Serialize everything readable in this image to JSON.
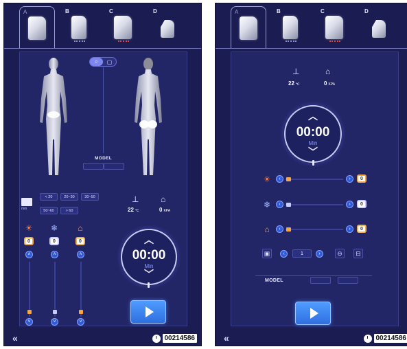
{
  "tabs": [
    {
      "letter": "A",
      "active": true
    },
    {
      "letter": "B",
      "active": false,
      "dots": "blue"
    },
    {
      "letter": "C",
      "active": false,
      "dots": "red"
    },
    {
      "letter": "D",
      "active": false
    }
  ],
  "left_panel": {
    "model_label": "MODEL",
    "view_toggle": [
      "⌕",
      "▢"
    ],
    "ranges": [
      "< 20",
      "20~30",
      "30~50",
      "50~60",
      "> 60"
    ],
    "mm_label": "mm",
    "temperature": {
      "value": "22",
      "unit": "℃"
    },
    "pressure": {
      "value": "0",
      "unit": "KPA"
    },
    "controls": [
      {
        "name": "heat",
        "value": "0",
        "color": "#ff7a3a"
      },
      {
        "name": "cool",
        "value": "0",
        "color": "#9fb6ff"
      },
      {
        "name": "vacuum",
        "value": "0",
        "color": "#e8a06a"
      }
    ],
    "timer": {
      "value": "00:00",
      "unit": "Min"
    }
  },
  "right_panel": {
    "temperature": {
      "value": "22",
      "unit": "℃"
    },
    "pressure": {
      "value": "0",
      "unit": "KPA"
    },
    "timer": {
      "value": "00:00",
      "unit": "Min"
    },
    "rows": [
      {
        "name": "heat",
        "value": "0"
      },
      {
        "name": "cool",
        "value": "0"
      },
      {
        "name": "vacuum",
        "value": "0"
      }
    ],
    "program_number": "1",
    "model_label": "MODEL"
  },
  "footer": {
    "back": "«",
    "serial": "00214586"
  },
  "colors": {
    "background": "#1b1c52",
    "accent": "#f5a742",
    "button": "#2f6fe0"
  }
}
